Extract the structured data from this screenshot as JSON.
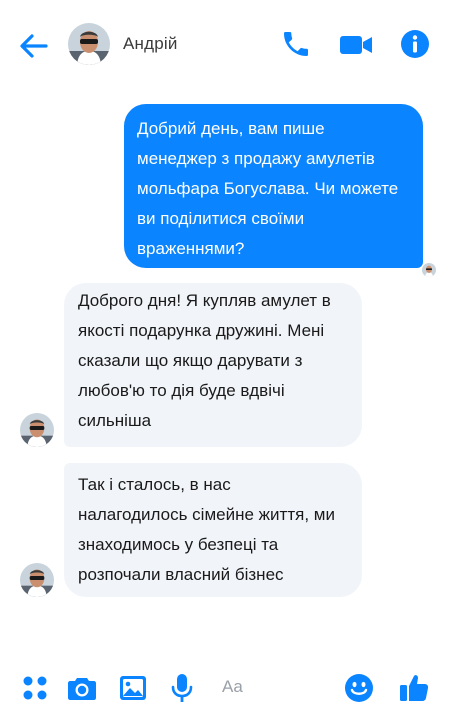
{
  "colors": {
    "accent": "#0a84ff",
    "incoming_bubble": "#f1f4f9",
    "outgoing_text": "#ffffff"
  },
  "header": {
    "contact_name": "Андрій",
    "icons": [
      "back-arrow-icon",
      "phone-icon",
      "video-camera-icon",
      "info-icon"
    ]
  },
  "messages": [
    {
      "direction": "outgoing",
      "lines": [
        "Добрий день, вам пише",
        "менеджер з продажу амулетів",
        "мольфара Богуслава. Чи можете",
        "ви поділитися своїми",
        "враженнями?"
      ]
    },
    {
      "direction": "incoming",
      "lines": [
        "Доброго дня! Я купляв амулет в",
        "якості подарунка дружині. Мені",
        "сказали що якщо дарувати з",
        "любов'ю то дія буде вдвічі",
        "сильніша"
      ]
    },
    {
      "direction": "incoming",
      "lines": [
        "Так і сталось, в нас",
        "налагодилось сімейне життя, ми",
        "знаходимось у безпеці та",
        "розпочали власний бізнес"
      ]
    }
  ],
  "composer": {
    "placeholder": "Aa",
    "icons": [
      "apps-icon",
      "camera-icon",
      "gallery-icon",
      "microphone-icon",
      "emoji-icon",
      "thumbs-up-icon"
    ]
  }
}
